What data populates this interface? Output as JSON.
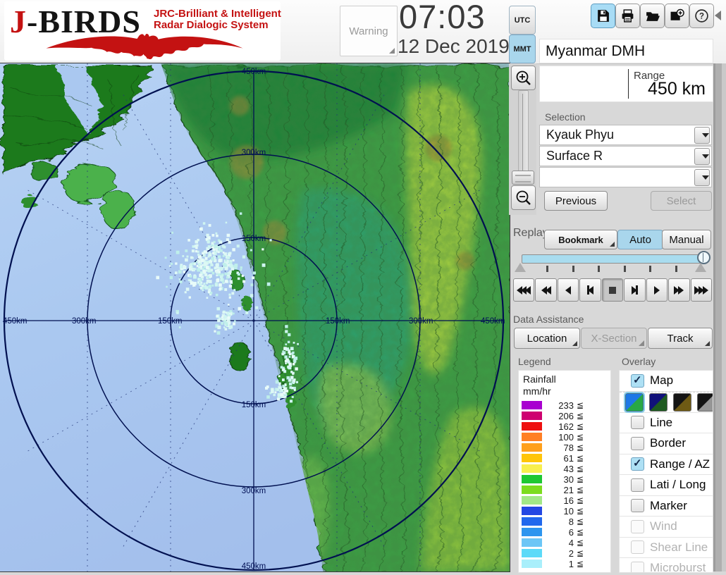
{
  "header": {
    "logo": {
      "j": "J",
      "birds": "-BIRDS",
      "tagline1": "JRC-Brilliant & Intelligent",
      "tagline2": "Radar  Dialogic  System"
    },
    "warning_label": "Warning",
    "time": "07:03",
    "date": "12 Dec 2019",
    "tz": {
      "utc": "UTC",
      "mmt": "MMT",
      "selected": "MMT"
    },
    "toolbar_icons": [
      "save",
      "print",
      "open-folder",
      "add-image",
      "help"
    ]
  },
  "panel": {
    "station_name": "Myanmar DMH",
    "range": {
      "label": "Range",
      "value": "450 km"
    },
    "selection": {
      "label": "Selection",
      "values": [
        "Kyauk Phyu",
        "Surface R",
        ""
      ],
      "previous": "Previous",
      "select": "Select"
    },
    "replay": {
      "label": "Replay",
      "bookmark": "Bookmark",
      "auto": "Auto",
      "manual": "Manual",
      "mode_selected": "Auto",
      "playback": [
        "fast-rewind-triple",
        "fast-rewind",
        "play-reverse",
        "step-backward",
        "stop",
        "step-forward",
        "play",
        "fast-forward",
        "fast-forward-triple"
      ],
      "pressed": "stop"
    },
    "data_assistance": {
      "label": "Data Assistance",
      "buttons": [
        {
          "label": "Location",
          "enabled": true
        },
        {
          "label": "X-Section",
          "enabled": false
        },
        {
          "label": "Track",
          "enabled": true
        }
      ]
    }
  },
  "legend": {
    "label": "Legend",
    "unit1": "Rainfall",
    "unit2": "mm/hr",
    "lte": "≦",
    "entries": [
      {
        "value": "233",
        "color": "#A800D0"
      },
      {
        "value": "206",
        "color": "#CE0070"
      },
      {
        "value": "162",
        "color": "#EE1010"
      },
      {
        "value": "100",
        "color": "#FF7F24"
      },
      {
        "value": "78",
        "color": "#FFA01C"
      },
      {
        "value": "61",
        "color": "#FFC50A"
      },
      {
        "value": "43",
        "color": "#F8EF4E"
      },
      {
        "value": "30",
        "color": "#1EC832"
      },
      {
        "value": "21",
        "color": "#7CDC1E"
      },
      {
        "value": "16",
        "color": "#A2E886"
      },
      {
        "value": "10",
        "color": "#2347E3"
      },
      {
        "value": "8",
        "color": "#2168ED"
      },
      {
        "value": "6",
        "color": "#2D95EF"
      },
      {
        "value": "4",
        "color": "#6CC6F6"
      },
      {
        "value": "2",
        "color": "#5CDAF8"
      },
      {
        "value": "1",
        "color": "#A9EFFB"
      }
    ]
  },
  "overlay": {
    "label": "Overlay",
    "items": [
      {
        "label": "Map",
        "checked": true,
        "enabled": true
      },
      {
        "label": "Line",
        "checked": false,
        "enabled": true
      },
      {
        "label": "Border",
        "checked": false,
        "enabled": true
      },
      {
        "label": "Range / AZ",
        "checked": true,
        "enabled": true
      },
      {
        "label": "Lati / Long",
        "checked": false,
        "enabled": true
      },
      {
        "label": "Marker",
        "checked": false,
        "enabled": true
      },
      {
        "label": "Wind",
        "checked": false,
        "enabled": false
      },
      {
        "label": "Shear Line",
        "checked": false,
        "enabled": false
      },
      {
        "label": "Microburst",
        "checked": false,
        "enabled": false
      }
    ],
    "map_styles": [
      {
        "name": "style-blue-green",
        "top": "#1E78E6",
        "bottom": "#28A846",
        "selected": true
      },
      {
        "name": "style-navy-darkgreen",
        "top": "#10107A",
        "bottom": "#1E5A20",
        "selected": false
      },
      {
        "name": "style-black-olive",
        "top": "#141414",
        "bottom": "#6E5A14",
        "selected": false
      },
      {
        "name": "style-black-gray",
        "top": "#141414",
        "bottom": "#969696",
        "selected": false
      }
    ]
  },
  "map": {
    "labels_top": [
      "450km",
      "300km",
      "150km"
    ],
    "labels_bottom": [
      "150km",
      "300km",
      "450km"
    ],
    "labels_left": [
      "450km",
      "300km",
      "150km"
    ],
    "labels_right": [
      "150km",
      "300km",
      "450km"
    ]
  }
}
